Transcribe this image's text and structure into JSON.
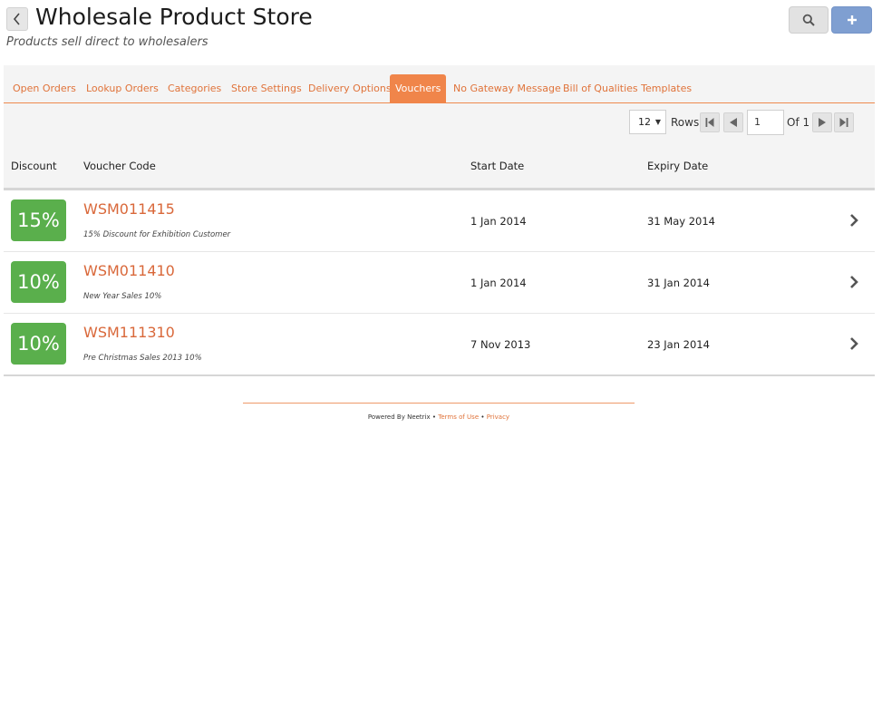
{
  "header": {
    "title": "Wholesale Product Store",
    "subtitle": "Products sell direct to wholesalers",
    "back_icon": "chevron-left-icon",
    "search_icon": "search-icon",
    "add_icon": "plus-icon",
    "add_button_color": "#7f9fd1"
  },
  "tabs": [
    {
      "label": "Open Orders",
      "active": false
    },
    {
      "label": "Lookup Orders",
      "active": false
    },
    {
      "label": "Categories",
      "active": false
    },
    {
      "label": "Store Settings",
      "active": false
    },
    {
      "label": "Delivery Options",
      "active": false
    },
    {
      "label": "Vouchers",
      "active": true
    },
    {
      "label": "No Gateway Message",
      "active": false
    },
    {
      "label": "Bill of Qualities Templates",
      "active": false
    }
  ],
  "pager": {
    "rows_value": "12",
    "rows_label": "Rows",
    "page_value": "1",
    "of_label": "Of 1"
  },
  "table": {
    "columns": [
      "Discount",
      "Voucher Code",
      "Start Date",
      "Expiry Date"
    ],
    "rows": [
      {
        "discount": "15%",
        "code": "WSM011415",
        "description": "15% Discount for Exhibition Customer",
        "start": "1 Jan 2014",
        "expiry": "31 May 2014"
      },
      {
        "discount": "10%",
        "code": "WSM011410",
        "description": "New Year Sales 10%",
        "start": "1 Jan 2014",
        "expiry": "31 Jan 2014"
      },
      {
        "discount": "10%",
        "code": "WSM111310",
        "description": "Pre Christmas Sales 2013 10%",
        "start": "7 Nov 2013",
        "expiry": "23 Jan 2014"
      }
    ]
  },
  "footer": {
    "powered_by": "Powered By Neetrix",
    "separator": " • ",
    "terms": "Terms of Use",
    "privacy": "Privacy"
  },
  "colors": {
    "accent": "#f0854a",
    "link": "#d9683a",
    "badge": "#5aaf4c"
  }
}
